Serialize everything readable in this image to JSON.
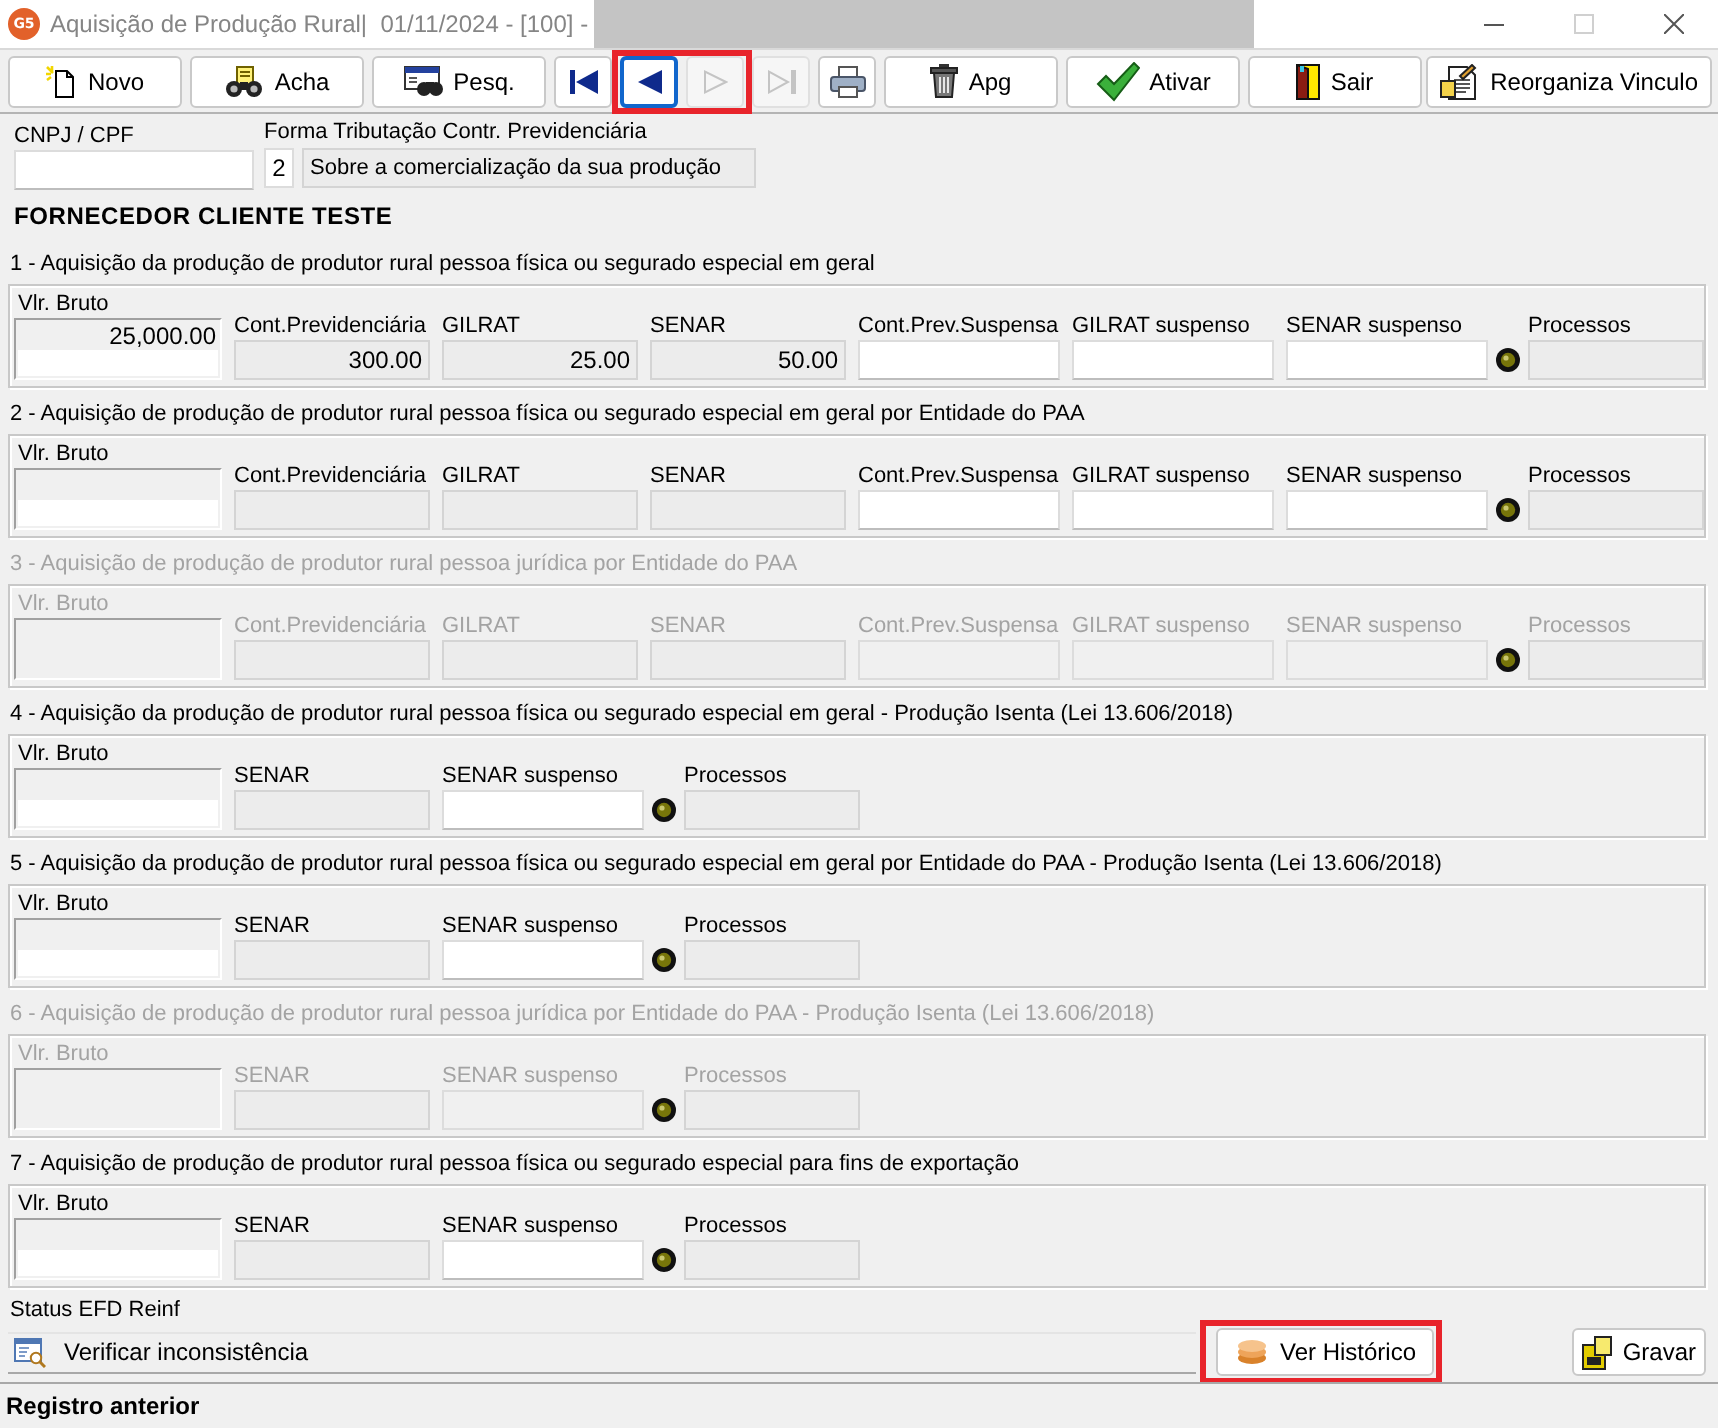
{
  "window": {
    "logo": "G5",
    "title": "Aquisição de Produção Rural|  01/11/2024 - [100] -",
    "redacted": true,
    "controls": [
      {
        "kind": "minimize",
        "disabled": false
      },
      {
        "kind": "maximize",
        "disabled": true
      },
      {
        "kind": "close",
        "disabled": false
      }
    ]
  },
  "toolbar": {
    "left": [
      {
        "kind": "new",
        "label": "Novo",
        "disabled": false,
        "focused": false,
        "highlighted": false
      },
      {
        "kind": "find",
        "label": "Acha",
        "disabled": false,
        "focused": false,
        "highlighted": false
      },
      {
        "kind": "search",
        "label": "Pesq.",
        "disabled": false,
        "focused": false,
        "highlighted": false
      },
      {
        "kind": "first",
        "disabled": false,
        "focused": false,
        "highlighted": false
      },
      {
        "kind": "previous",
        "disabled": false,
        "focused": true,
        "highlighted": true
      },
      {
        "kind": "next",
        "disabled": true,
        "focused": false,
        "highlighted": true
      },
      {
        "kind": "last",
        "disabled": true,
        "focused": false,
        "highlighted": false
      },
      {
        "kind": "print",
        "disabled": false,
        "focused": false,
        "highlighted": false
      },
      {
        "kind": "delete",
        "label": "Apg",
        "disabled": false,
        "focused": false,
        "highlighted": false
      },
      {
        "kind": "activate",
        "label": "Ativar",
        "disabled": false,
        "focused": false,
        "highlighted": false
      },
      {
        "kind": "exit",
        "label": "Sair",
        "disabled": false,
        "focused": false,
        "highlighted": false
      }
    ],
    "right": [
      {
        "kind": "relink",
        "label": "Reorganiza Vinculo",
        "disabled": false,
        "focused": false,
        "highlighted": false
      }
    ]
  },
  "taxpayer": {
    "cnpj_label": "CNPJ / CPF",
    "tax_form_label": "Forma Tributação Contr. Previdenciária",
    "tax_form_code": "2",
    "tax_form_description": "Sobre a comercialização da sua produção"
  },
  "supplier_name": "FORNECEDOR CLIENTE TESTE",
  "sections": [
    {
      "title": "1 - Aquisição da produção de produtor rural pessoa física ou segurado especial em geral",
      "disabled": false,
      "gross": {
        "label": "Vlr. Bruto",
        "value": "25,000.00"
      },
      "fields": [
        {
          "kind": "readonly",
          "label": "Cont.Previdenciária",
          "value": "300.00"
        },
        {
          "kind": "readonly",
          "label": "GILRAT",
          "value": "25.00"
        },
        {
          "kind": "readonly",
          "label": "SENAR",
          "value": "50.00"
        },
        {
          "kind": "input",
          "label": "Cont.Prev.Suspensa"
        },
        {
          "kind": "input",
          "label": "GILRAT suspenso"
        },
        {
          "kind": "input",
          "label": "SENAR suspenso"
        },
        {
          "kind": "lookup",
          "label": "Processos"
        }
      ]
    },
    {
      "title": "2 - Aquisição de produção de produtor rural pessoa física ou segurado especial em geral por Entidade do PAA",
      "disabled": false,
      "gross": {
        "label": "Vlr. Bruto"
      },
      "fields": [
        {
          "kind": "readonly",
          "label": "Cont.Previdenciária"
        },
        {
          "kind": "readonly",
          "label": "GILRAT"
        },
        {
          "kind": "readonly",
          "label": "SENAR"
        },
        {
          "kind": "input",
          "label": "Cont.Prev.Suspensa"
        },
        {
          "kind": "input",
          "label": "GILRAT suspenso"
        },
        {
          "kind": "input",
          "label": "SENAR suspenso"
        },
        {
          "kind": "lookup",
          "label": "Processos"
        }
      ]
    },
    {
      "title": "3 - Aquisição de produção de produtor rural pessoa jurídica por Entidade do PAA",
      "disabled": true,
      "gross": {
        "label": "Vlr. Bruto"
      },
      "fields": [
        {
          "kind": "readonly",
          "label": "Cont.Previdenciária"
        },
        {
          "kind": "readonly",
          "label": "GILRAT"
        },
        {
          "kind": "readonly",
          "label": "SENAR"
        },
        {
          "kind": "input",
          "label": "Cont.Prev.Suspensa"
        },
        {
          "kind": "input",
          "label": "GILRAT suspenso"
        },
        {
          "kind": "input",
          "label": "SENAR suspenso"
        },
        {
          "kind": "lookup",
          "label": "Processos"
        }
      ]
    },
    {
      "title": "4 - Aquisição da produção de produtor rural pessoa física ou segurado especial em geral - Produção Isenta (Lei 13.606/2018)",
      "disabled": false,
      "gross": {
        "label": "Vlr. Bruto"
      },
      "fields": [
        {
          "kind": "readonly",
          "label": "SENAR"
        },
        {
          "kind": "input",
          "label": "SENAR suspenso"
        },
        {
          "kind": "lookup",
          "label": "Processos"
        }
      ]
    },
    {
      "title": "5 - Aquisição da produção de produtor rural pessoa física ou segurado especial em geral por Entidade do PAA - Produção Isenta (Lei 13.606/2018)",
      "disabled": false,
      "gross": {
        "label": "Vlr. Bruto"
      },
      "fields": [
        {
          "kind": "readonly",
          "label": "SENAR"
        },
        {
          "kind": "input",
          "label": "SENAR suspenso"
        },
        {
          "kind": "lookup",
          "label": "Processos"
        }
      ]
    },
    {
      "title": "6 - Aquisição de produção de produtor rural pessoa jurídica por Entidade do PAA - Produção Isenta (Lei 13.606/2018)",
      "disabled": true,
      "gross": {
        "label": "Vlr. Bruto"
      },
      "fields": [
        {
          "kind": "readonly",
          "label": "SENAR"
        },
        {
          "kind": "input",
          "label": "SENAR suspenso"
        },
        {
          "kind": "lookup",
          "label": "Processos"
        }
      ]
    },
    {
      "title": "7 - Aquisição de produção de produtor rural pessoa física ou segurado especial para fins de exportação",
      "disabled": false,
      "gross": {
        "label": "Vlr. Bruto"
      },
      "fields": [
        {
          "kind": "readonly",
          "label": "SENAR"
        },
        {
          "kind": "input",
          "label": "SENAR suspenso"
        },
        {
          "kind": "lookup",
          "label": "Processos"
        }
      ]
    }
  ],
  "reinf": {
    "label": "Status EFD Reinf",
    "status": "Verificar inconsistência"
  },
  "footer": {
    "left": [
      {
        "kind": "history",
        "label": "Ver Histórico",
        "highlighted": true
      }
    ],
    "right": [
      {
        "kind": "save",
        "label": "Gravar",
        "highlighted": false
      }
    ]
  },
  "status_bar": "Registro anterior"
}
